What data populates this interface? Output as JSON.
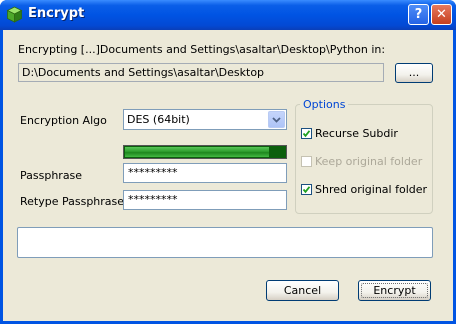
{
  "window": {
    "title": "Encrypt",
    "help_label": "?",
    "close_label": "✕",
    "app_icon": "green-cube-icon"
  },
  "source": {
    "label": "Encrypting [...]Documents and Settings\\asaltar\\Desktop\\Python in:",
    "path": "D:\\Documents and Settings\\asaltar\\Desktop",
    "browse_label": "..."
  },
  "algo": {
    "label": "Encryption Algo",
    "selected": "DES (64bit)"
  },
  "strength": {
    "level": 0.9,
    "color": "#2e9e2e"
  },
  "passphrase": {
    "label": "Passphrase",
    "value": "*********"
  },
  "retype": {
    "label": "Retype Passphrase",
    "value": "*********"
  },
  "options": {
    "title": "Options",
    "recurse": {
      "label": "Recurse Subdir",
      "checked": true,
      "enabled": true
    },
    "keep": {
      "label": "Keep original folder",
      "checked": false,
      "enabled": false
    },
    "shred": {
      "label": "Shred original folder",
      "checked": true,
      "enabled": true
    }
  },
  "status": {
    "text": ""
  },
  "buttons": {
    "cancel": "Cancel",
    "encrypt": "Encrypt"
  }
}
